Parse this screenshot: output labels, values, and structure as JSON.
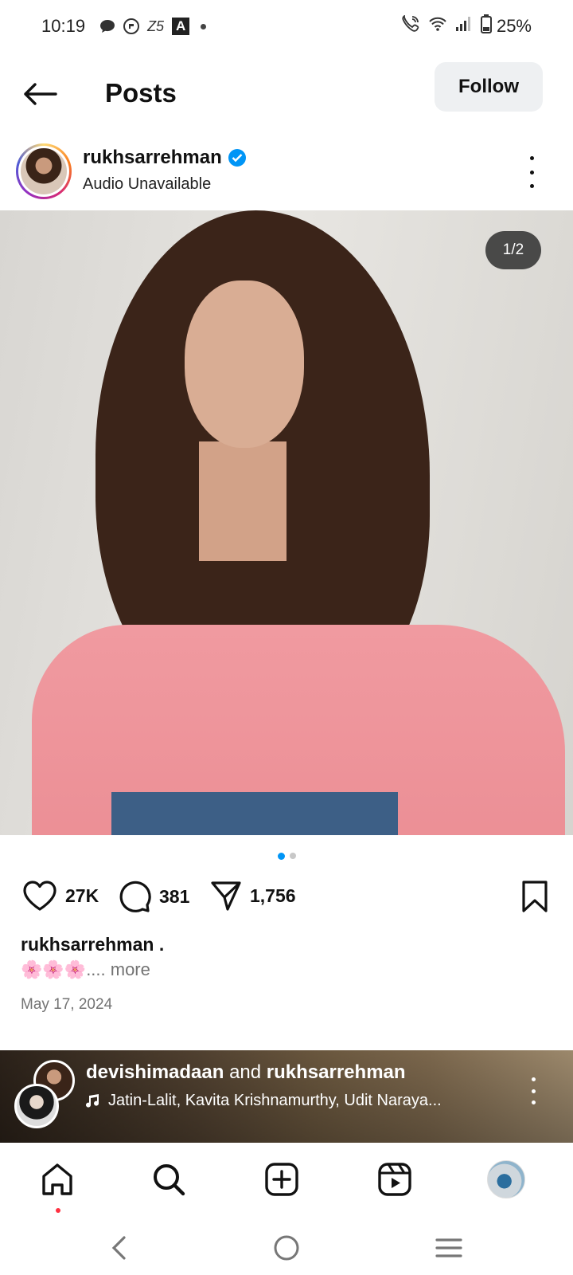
{
  "status_bar": {
    "time": "10:19",
    "battery": "25%",
    "icons_left": [
      "chat-bubble-icon",
      "app-notification-icon",
      "zee5-icon",
      "a-app-icon",
      "dot-icon"
    ],
    "z5_label": "Z5",
    "a_label": "A",
    "icons_right": [
      "wifi-call-icon",
      "wifi-icon",
      "signal-icon",
      "battery-icon"
    ]
  },
  "header": {
    "title": "Posts",
    "follow_label": "Follow"
  },
  "post": {
    "username": "rukhsarrehman",
    "verified": true,
    "audio_label": "Audio Unavailable",
    "image_counter": "1/2",
    "carousel_total": 2,
    "carousel_index": 1,
    "likes": "27K",
    "comments": "381",
    "shares": "1,756",
    "caption_user": "rukhsarrehman .",
    "caption_emojis": "🌸🌸🌸",
    "caption_more": ".... more",
    "date": "May 17, 2024"
  },
  "next_post": {
    "user1": "devishimadaan",
    "joiner": " and ",
    "user2": "rukhsarrehman",
    "audio": "Jatin-Lalit, Kavita Krishnamurthy, Udit Naraya..."
  },
  "colors": {
    "accent": "#0095f6",
    "notification": "#ff3040",
    "muted_text": "#737373",
    "follow_bg": "#eef0f2"
  }
}
